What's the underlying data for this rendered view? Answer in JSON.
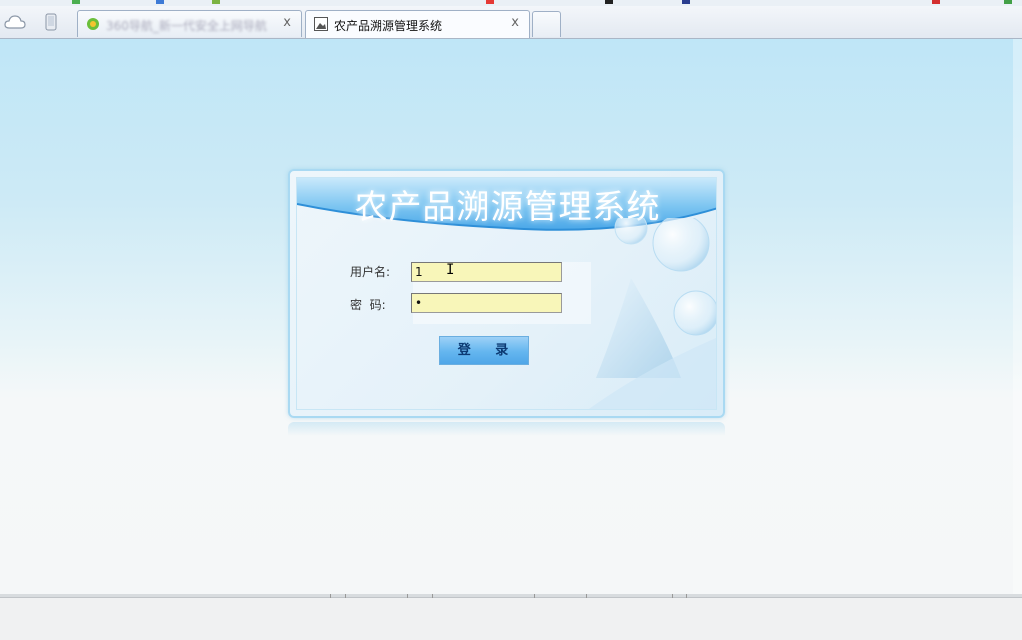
{
  "browser": {
    "tabs": [
      {
        "title": "360导航_新一代安全上网导航",
        "active": false,
        "close_label": "x"
      },
      {
        "title": "农产品溯源管理系统",
        "active": true,
        "close_label": "x"
      }
    ]
  },
  "login": {
    "banner_title": "农产品溯源管理系统",
    "username_label": "用户名:",
    "username_value": "1",
    "password_label": "密  码:",
    "password_value": "•",
    "submit_label": "登 录"
  },
  "colors": {
    "page_top": "#bfe6f7",
    "field_bg": "#f8f6b9",
    "button": "#64b6ef"
  }
}
